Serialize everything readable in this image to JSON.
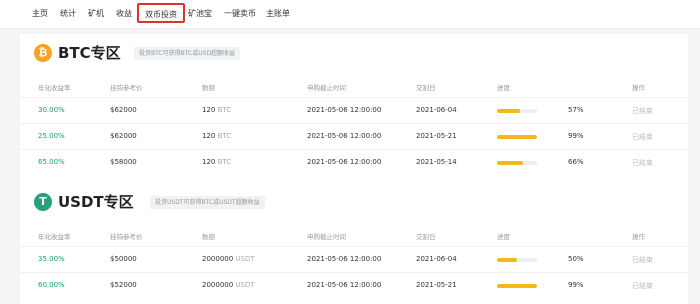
{
  "nav": {
    "items": [
      "主页",
      "统计",
      "矿机",
      "收益",
      "双币投资",
      "矿池宝",
      "一键卖币",
      "主账单"
    ],
    "active": "双币投资"
  },
  "columns": [
    "年化收益率",
    "挂钩参考价",
    "数额",
    "申购截止时间",
    "交割日",
    "进度",
    "操作"
  ],
  "btc": {
    "icon": "₿",
    "title": "BTC专区",
    "note": "投资BTC可获得BTC或USD超额收益",
    "rows": [
      {
        "rate": "30.00%",
        "price": "$62000",
        "amount": "120",
        "unit": "BTC",
        "deadline": "2021-05-06 12:00:00",
        "delivery": "2021-06-04",
        "progress": 0.57,
        "pct": "57%",
        "action": "已结束"
      },
      {
        "rate": "25.00%",
        "price": "$62000",
        "amount": "120",
        "unit": "BTC",
        "deadline": "2021-05-06 12:00:00",
        "delivery": "2021-05-21",
        "progress": 0.99,
        "pct": "99%",
        "action": "已结束"
      },
      {
        "rate": "65.00%",
        "price": "$58000",
        "amount": "120",
        "unit": "BTC",
        "deadline": "2021-05-06 12:00:00",
        "delivery": "2021-05-14",
        "progress": 0.66,
        "pct": "66%",
        "action": "已结束"
      }
    ]
  },
  "usdt": {
    "icon": "T",
    "title": "USDT专区",
    "note": "投资USDT可获得BTC或USDT超额收益",
    "rows": [
      {
        "rate": "35.00%",
        "price": "$50000",
        "amount": "2000000",
        "unit": "USDT",
        "deadline": "2021-05-06 12:00:00",
        "delivery": "2021-06-04",
        "progress": 0.5,
        "pct": "50%",
        "action": "已结束"
      },
      {
        "rate": "60.00%",
        "price": "$52000",
        "amount": "2000000",
        "unit": "USDT",
        "deadline": "2021-05-06 12:00:00",
        "delivery": "2021-05-21",
        "progress": 0.99,
        "pct": "99%",
        "action": "已结束"
      }
    ]
  },
  "colors": {
    "accent": "#e0302b",
    "rate": "#1aa260",
    "progress": "#f2b91d",
    "btc": "#f7a128",
    "usdt": "#26a17b"
  }
}
